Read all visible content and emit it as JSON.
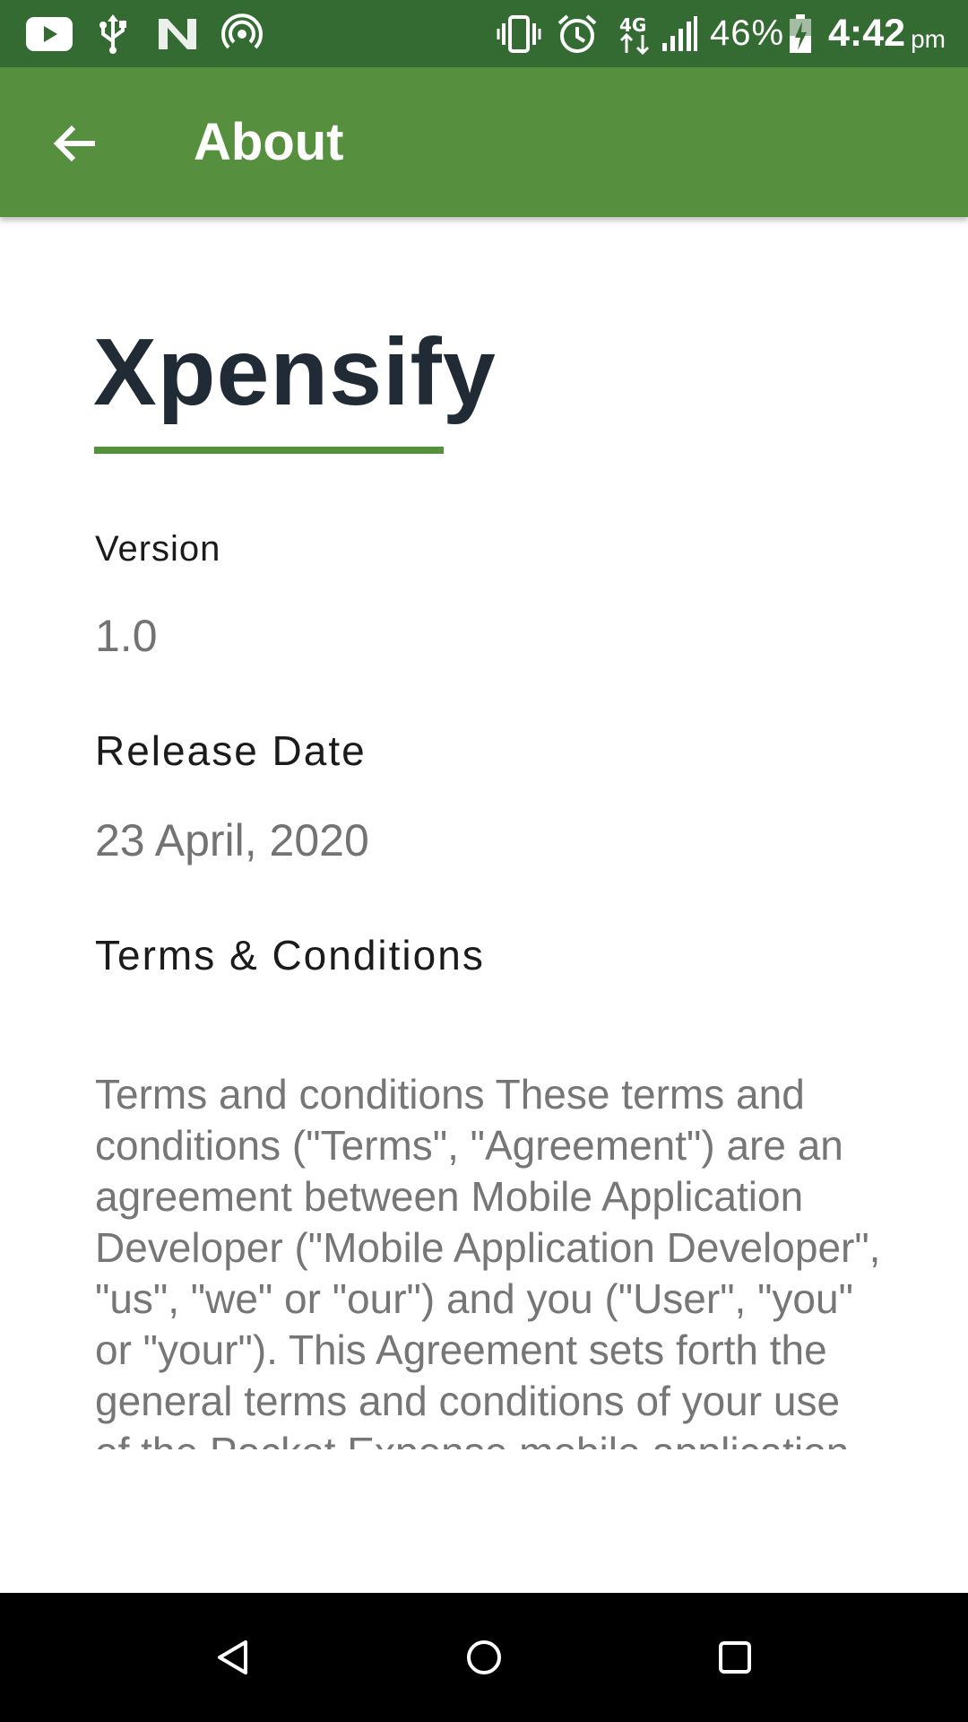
{
  "status_bar": {
    "battery_percent": "46%",
    "time": "4:42",
    "ampm": "pm",
    "icons": [
      "youtube-icon",
      "usb-icon",
      "n-app-icon",
      "hotspot-icon",
      "vibrate-icon",
      "alarm-icon",
      "data-4g-icon",
      "signal-icon",
      "battery-icon"
    ]
  },
  "app_bar": {
    "title": "About",
    "back_icon": "arrow-left-icon"
  },
  "about": {
    "app_name": "Xpensify",
    "version_label": "Version",
    "version_value": "1.0",
    "release_date_label": "Release Date",
    "release_date_value": "23 April, 2020",
    "terms_label": "Terms & Conditions",
    "terms_text": "Terms and conditions These terms and conditions (\"Terms\", \"Agreement\") are an agreement between Mobile Application Developer (\"Mobile Application Developer\", \"us\", \"we\" or \"our\") and you (\"User\", \"you\" or \"your\"). This Agreement sets forth the general terms and conditions of your use of the Pocket Expense mobile application and any of"
  },
  "colors": {
    "status_bar": "#336b33",
    "app_bar": "#568f3d",
    "accent": "#568f3d",
    "title_text": "#212b35"
  },
  "nav_bar": {
    "icons": [
      "back-triangle-icon",
      "home-circle-icon",
      "recents-square-icon"
    ]
  }
}
